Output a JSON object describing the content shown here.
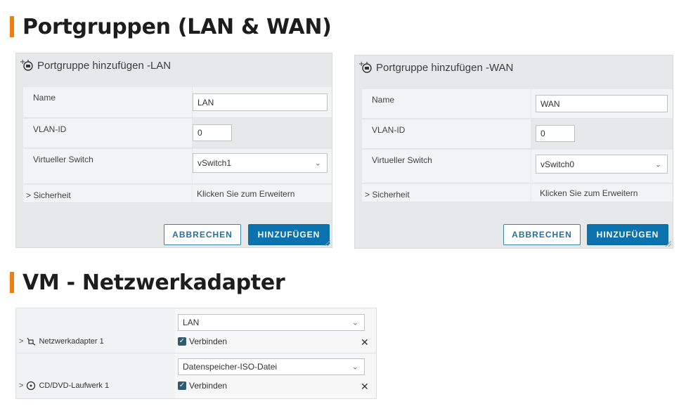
{
  "section1": {
    "title": "Portgruppen (LAN & WAN)"
  },
  "section2": {
    "title": "VM - Netzwerkadapter"
  },
  "lan_dialog": {
    "title": "Portgruppe hinzufügen -LAN",
    "icon": "add-portgroup-icon",
    "name_label": "Name",
    "name_value": "LAN",
    "vlan_label": "VLAN-ID",
    "vlan_value": "0",
    "switch_label": "Virtueller Switch",
    "switch_value": "vSwitch1",
    "security_label": "Sicherheit",
    "security_hint": "Klicken Sie zum Erweitern",
    "cancel_label": "ABBRECHEN",
    "add_label": "HINZUFÜGEN"
  },
  "wan_dialog": {
    "title": "Portgruppe hinzufügen -WAN",
    "icon": "add-portgroup-icon",
    "name_label": "Name",
    "name_value": "WAN",
    "vlan_label": "VLAN-ID",
    "vlan_value": "0",
    "switch_label": "Virtueller Switch",
    "switch_value": "vSwitch0",
    "security_label": "Sicherheit",
    "security_hint": "Klicken Sie zum Erweitern",
    "cancel_label": "ABBRECHEN",
    "add_label": "HINZUFÜGEN"
  },
  "vm": {
    "adapter_label": "Netzwerkadapter 1",
    "adapter_network": "LAN",
    "adapter_connect": "Verbinden",
    "cd_label": "CD/DVD-Laufwerk 1",
    "cd_source": "Datenspeicher-ISO-Datei",
    "cd_connect": "Verbinden"
  },
  "colors": {
    "accent": "#f07f13",
    "primary_button": "#0b72ad",
    "checkbox": "#2d5b73"
  }
}
